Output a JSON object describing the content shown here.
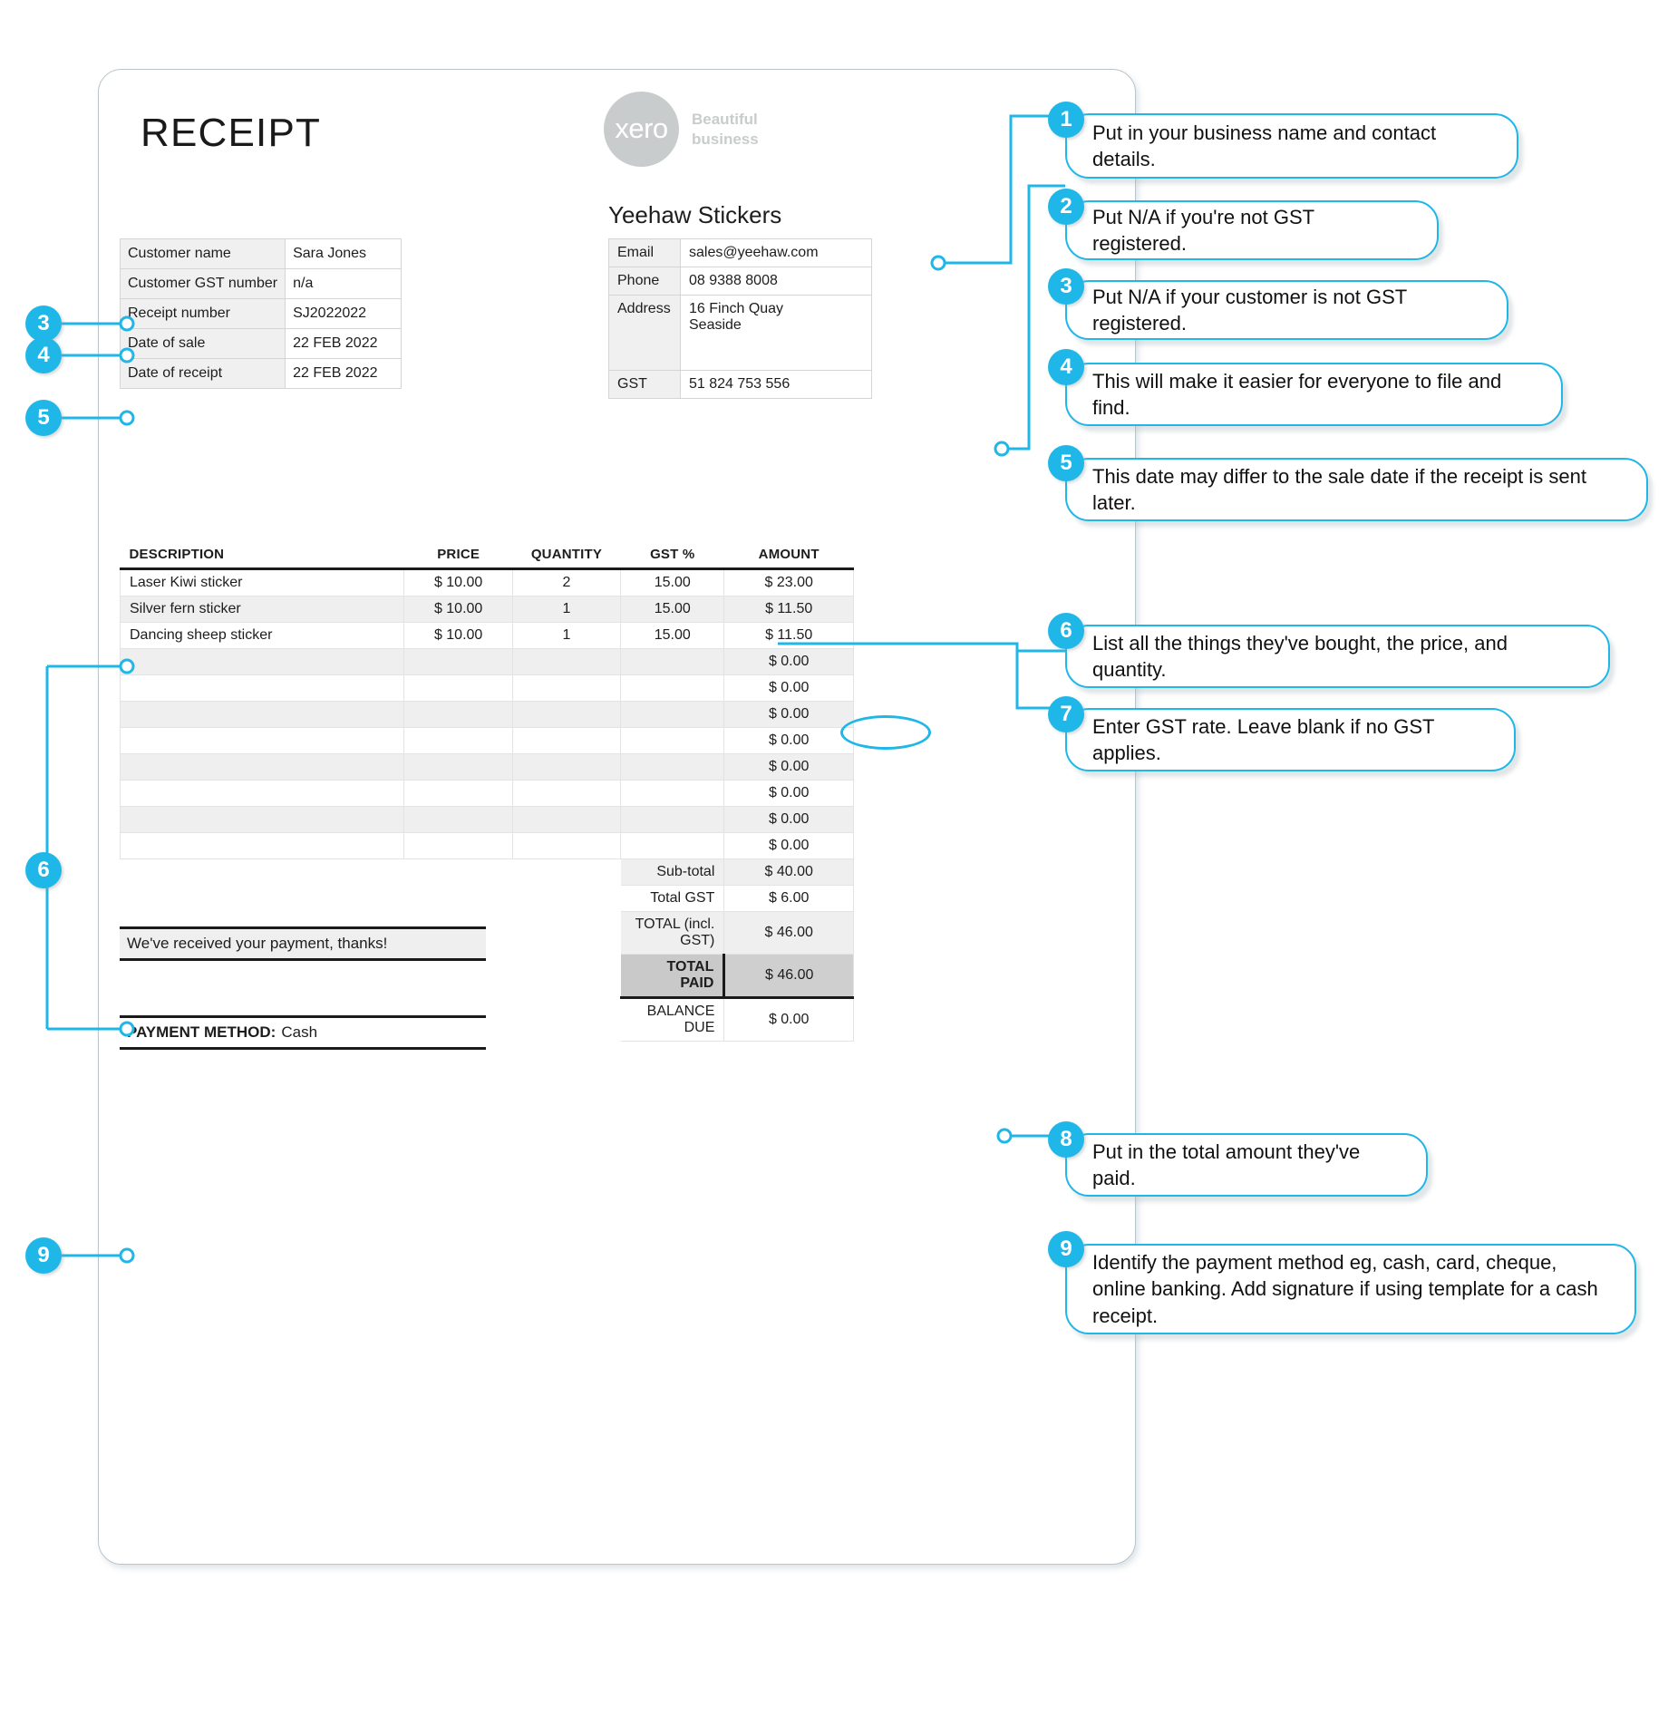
{
  "document": {
    "title": "RECEIPT"
  },
  "brand": {
    "logo_word": "xero",
    "logo_icon": "xero-logo-icon",
    "tagline_line1": "Beautiful",
    "tagline_line2": "business",
    "accent_color": "#1fb6e8",
    "logo_color": "#c9cccd"
  },
  "customer_table": {
    "rows": [
      {
        "label": "Customer name",
        "value": "Sara Jones"
      },
      {
        "label": "Customer GST number",
        "value": "n/a"
      },
      {
        "label": "Receipt number",
        "value": "SJ2022022"
      },
      {
        "label": "Date of sale",
        "value": "22 FEB 2022"
      },
      {
        "label": "Date of receipt",
        "value": "22 FEB 2022"
      }
    ]
  },
  "business": {
    "name": "Yeehaw Stickers",
    "rows": [
      {
        "label": "Email",
        "value": "sales@yeehaw.com"
      },
      {
        "label": "Phone",
        "value": "08 9388 8008"
      },
      {
        "label": "Address",
        "value": "16 Finch Quay",
        "value2": "Seaside"
      },
      {
        "label": "GST",
        "value": "51 824 753 556"
      }
    ]
  },
  "items_table": {
    "headers": {
      "description": "DESCRIPTION",
      "price": "PRICE",
      "quantity": "QUANTITY",
      "gst": "GST %",
      "amount": "AMOUNT"
    },
    "rows": [
      {
        "description": "Laser Kiwi sticker",
        "price": "$ 10.00",
        "quantity": "2",
        "gst": "15.00",
        "amount": "$ 23.00"
      },
      {
        "description": "Silver fern sticker",
        "price": "$ 10.00",
        "quantity": "1",
        "gst": "15.00",
        "amount": "$ 11.50"
      },
      {
        "description": "Dancing sheep sticker",
        "price": "$ 10.00",
        "quantity": "1",
        "gst": "15.00",
        "amount": "$ 11.50"
      },
      {
        "description": "",
        "price": "",
        "quantity": "",
        "gst": "",
        "amount": "$ 0.00"
      },
      {
        "description": "",
        "price": "",
        "quantity": "",
        "gst": "",
        "amount": "$ 0.00"
      },
      {
        "description": "",
        "price": "",
        "quantity": "",
        "gst": "",
        "amount": "$ 0.00"
      },
      {
        "description": "",
        "price": "",
        "quantity": "",
        "gst": "",
        "amount": "$ 0.00"
      },
      {
        "description": "",
        "price": "",
        "quantity": "",
        "gst": "",
        "amount": "$ 0.00"
      },
      {
        "description": "",
        "price": "",
        "quantity": "",
        "gst": "",
        "amount": "$ 0.00"
      },
      {
        "description": "",
        "price": "",
        "quantity": "",
        "gst": "",
        "amount": "$ 0.00"
      },
      {
        "description": "",
        "price": "",
        "quantity": "",
        "gst": "",
        "amount": "$ 0.00"
      }
    ],
    "totals": [
      {
        "label": "Sub-total",
        "value": "$ 40.00"
      },
      {
        "label": "Total GST",
        "value": "$ 6.00"
      },
      {
        "label": "TOTAL (incl. GST)",
        "value": "$ 46.00"
      },
      {
        "label": "TOTAL PAID",
        "value": "$ 46.00"
      },
      {
        "label": "BALANCE DUE",
        "value": "$ 0.00"
      }
    ]
  },
  "footer": {
    "note": "We've received your payment, thanks!",
    "payment_label": "PAYMENT METHOD:",
    "payment_value": "Cash"
  },
  "callouts": [
    {
      "number": "1",
      "text": "Put in your business name and contact details."
    },
    {
      "number": "2",
      "text": "Put N/A if you're not GST registered."
    },
    {
      "number": "3",
      "text": "Put N/A if your customer is not GST registered."
    },
    {
      "number": "4",
      "text": "This will make it easier for everyone to file and find."
    },
    {
      "number": "5",
      "text": "This date may differ to the sale date if the receipt is sent later."
    },
    {
      "number": "6",
      "text": "List all the things they've bought, the price, and quantity."
    },
    {
      "number": "7",
      "text": "Enter GST rate. Leave blank if no GST applies."
    },
    {
      "number": "8",
      "text": "Put in the total amount they've paid."
    },
    {
      "number": "9",
      "text": "Identify the payment method eg, cash, card, cheque, online banking. Add signature if using template for a cash receipt."
    }
  ],
  "left_markers": [
    {
      "number": "3"
    },
    {
      "number": "4"
    },
    {
      "number": "5"
    },
    {
      "number": "6"
    },
    {
      "number": "9"
    }
  ]
}
